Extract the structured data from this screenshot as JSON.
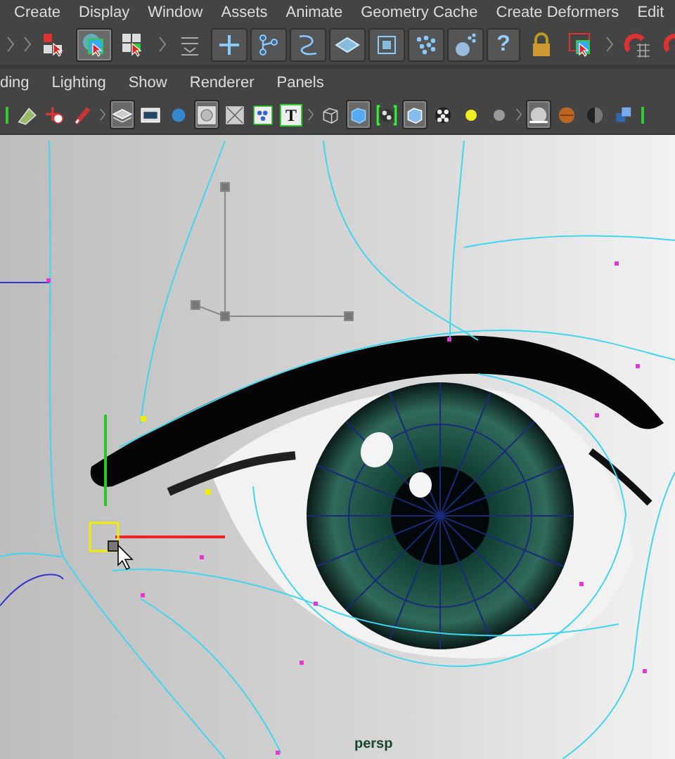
{
  "menu_bar": [
    "Create",
    "Display",
    "Window",
    "Assets",
    "Animate",
    "Geometry Cache",
    "Create Deformers",
    "Edit"
  ],
  "shelf": [
    {
      "kind": "handle",
      "selected": false
    },
    {
      "kind": "handle",
      "selected": false
    },
    {
      "kind": "hierarchy",
      "selected": false
    },
    {
      "kind": "object",
      "selected": true
    },
    {
      "kind": "component",
      "selected": false
    },
    {
      "kind": "handle",
      "selected": false
    },
    {
      "kind": "stack",
      "selected": false
    },
    {
      "kind": "snap_grid",
      "selected": false
    },
    {
      "kind": "snap_curve",
      "selected": false
    },
    {
      "kind": "snap_spline",
      "selected": false
    },
    {
      "kind": "snap_plane",
      "selected": false
    },
    {
      "kind": "snap_box",
      "selected": false
    },
    {
      "kind": "snap_points",
      "selected": false
    },
    {
      "kind": "sphere_dots",
      "selected": false
    },
    {
      "kind": "help",
      "selected": false,
      "label": "?"
    },
    {
      "kind": "lock",
      "selected": false
    },
    {
      "kind": "select_box",
      "selected": false
    },
    {
      "kind": "handle",
      "selected": false
    },
    {
      "kind": "magnet_grid",
      "selected": false
    },
    {
      "kind": "magnet_curve",
      "selected": false
    }
  ],
  "panel_menu": [
    "ding",
    "Lighting",
    "Show",
    "Renderer",
    "Panels"
  ],
  "panel_toolbar": [
    {
      "kind": "edge",
      "selected": false
    },
    {
      "kind": "camera",
      "selected": false
    },
    {
      "kind": "move_camera",
      "selected": false
    },
    {
      "kind": "pencil",
      "selected": false
    },
    {
      "kind": "handle",
      "selected": false
    },
    {
      "kind": "grid",
      "selected": true
    },
    {
      "kind": "film",
      "selected": false
    },
    {
      "kind": "ball",
      "selected": false
    },
    {
      "kind": "circle",
      "selected": true
    },
    {
      "kind": "xray",
      "selected": false
    },
    {
      "kind": "dots",
      "selected": false
    },
    {
      "kind": "text",
      "selected": false,
      "label": "T"
    },
    {
      "kind": "handle",
      "selected": false
    },
    {
      "kind": "wire_cube",
      "selected": false
    },
    {
      "kind": "cube",
      "selected": true
    },
    {
      "kind": "bracket_checker",
      "selected": false
    },
    {
      "kind": "outline_cube",
      "selected": true
    },
    {
      "kind": "checker",
      "selected": false
    },
    {
      "kind": "light",
      "selected": false
    },
    {
      "kind": "gray_light",
      "selected": false
    },
    {
      "kind": "handle",
      "selected": false
    },
    {
      "kind": "lit_sphere",
      "selected": true
    },
    {
      "kind": "orange_ball",
      "selected": false
    },
    {
      "kind": "half_ball",
      "selected": false
    },
    {
      "kind": "cubes",
      "selected": false
    },
    {
      "kind": "edge",
      "selected": false
    }
  ],
  "viewport": {
    "camera_label": "persp"
  }
}
